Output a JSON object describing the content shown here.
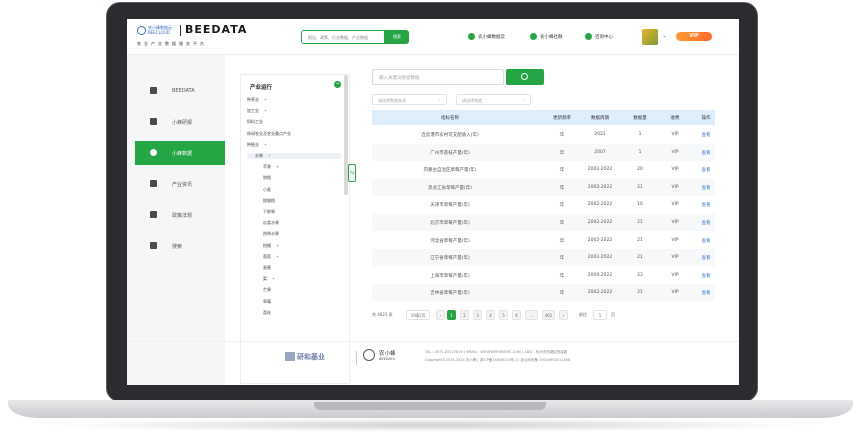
{
  "header": {
    "logo_cn": "农小蜂数据云",
    "logo_en": "BEECLOUD",
    "brand": "BEEDATA",
    "slogan": "农业产业数据服务平台",
    "search_placeholder": "报告、政策、行业数据、产业数据",
    "search_button": "搜索",
    "nav": [
      "农小蜂数据云",
      "农小蜂社群",
      "咨询中心"
    ],
    "vip": "VIP"
  },
  "sidebar": {
    "items": [
      {
        "label": "BEEDATA",
        "icon": "home-icon",
        "active": false
      },
      {
        "label": "小蜂研报",
        "icon": "report-icon",
        "active": false
      },
      {
        "label": "小蜂数据",
        "icon": "cloud-icon",
        "active": true
      },
      {
        "label": "产业资讯",
        "icon": "news-icon",
        "active": false
      },
      {
        "label": "政策法规",
        "icon": "grid-icon",
        "active": false
      },
      {
        "label": "搜索",
        "icon": "search-icon",
        "active": false
      }
    ]
  },
  "tree": {
    "title": "产业运行",
    "nodes": [
      {
        "label": "种养业",
        "plus": true,
        "indent": 0
      },
      {
        "label": "加工业",
        "plus": true,
        "indent": 0
      },
      {
        "label": "饲料工业",
        "plus": false,
        "indent": 0
      },
      {
        "label": "休闲农业及农业重点产业",
        "plus": false,
        "indent": 0
      },
      {
        "label": "种植业",
        "plus": true,
        "indent": 0
      },
      {
        "label": "水果",
        "plus": true,
        "indent": 1,
        "selected": true
      },
      {
        "label": "苹果",
        "plus": true,
        "indent": 2
      },
      {
        "label": "脐橙",
        "plus": false,
        "indent": 2
      },
      {
        "label": "小麦",
        "plus": false,
        "indent": 2
      },
      {
        "label": "猕猴桃",
        "plus": false,
        "indent": 2
      },
      {
        "label": "干鲜果",
        "plus": false,
        "indent": 2
      },
      {
        "label": "瓜类水果",
        "plus": false,
        "indent": 2
      },
      {
        "label": "热带水果",
        "plus": false,
        "indent": 2
      },
      {
        "label": "柑橘",
        "plus": true,
        "indent": 2
      },
      {
        "label": "葡萄",
        "plus": true,
        "indent": 2
      },
      {
        "label": "香蕉",
        "plus": false,
        "indent": 2
      },
      {
        "label": "梨",
        "plus": true,
        "indent": 2
      },
      {
        "label": "芒果",
        "plus": false,
        "indent": 2
      },
      {
        "label": "草莓",
        "plus": false,
        "indent": 2
      },
      {
        "label": "荔枝",
        "plus": false,
        "indent": 2
      }
    ]
  },
  "filters": {
    "search_placeholder": "输入关键词搜索数据",
    "select1": "请选择数据来源",
    "select2": "请选择频度"
  },
  "table": {
    "headers": [
      "指标名称",
      "更新频率",
      "数据周期",
      "数据量",
      "收费",
      "操作"
    ],
    "rows": [
      [
        "连云港市农村可支配收入(年)",
        "年",
        "2021",
        "1",
        "VIP",
        "查看"
      ],
      [
        "广州市荔枝产量(年)",
        "年",
        "2007",
        "1",
        "VIP",
        "查看"
      ],
      [
        "内蒙古自治区草莓产量(年)",
        "年",
        "2002-2022",
        "20",
        "VIP",
        "查看"
      ],
      [
        "黑龙江省草莓产量(年)",
        "年",
        "2002-2022",
        "21",
        "VIP",
        "查看"
      ],
      [
        "天津市草莓产量(年)",
        "年",
        "2002-2022",
        "10",
        "VIP",
        "查看"
      ],
      [
        "北京市草莓产量(年)",
        "年",
        "2002-2022",
        "21",
        "VIP",
        "查看"
      ],
      [
        "河北省草莓产量(年)",
        "年",
        "2002-2022",
        "21",
        "VIP",
        "查看"
      ],
      [
        "辽宁省草莓产量(年)",
        "年",
        "2002-2022",
        "21",
        "VIP",
        "查看"
      ],
      [
        "上海市草莓产量(年)",
        "年",
        "2000-2022",
        "23",
        "VIP",
        "查看"
      ],
      [
        "吉林省草莓产量(年)",
        "年",
        "2002-2022",
        "21",
        "VIP",
        "查看"
      ]
    ]
  },
  "pager": {
    "total": "共 4623 条",
    "page_size": "10条/页",
    "pages": [
      "1",
      "2",
      "3",
      "4",
      "5",
      "6",
      "...",
      "461"
    ],
    "current": "1",
    "goto_label": "前往",
    "goto_value": "1",
    "goto_unit": "页"
  },
  "footer": {
    "logo1": "研和基业",
    "logo2": "农小蜂",
    "logo2_en": "BEEDATA",
    "info1": "TEL：0571-85137819 | EMAIL：WEI@WEIHENGYC.COM | ADD：杭州市西湖区西溪路",
    "info2": "Copyright©2016-2024 农小蜂 | 浙ICP备16006024号-1 | 浙公网安备 33010602011608"
  },
  "colors": {
    "accent": "#24a644",
    "vip": "#ff7a2e",
    "table_header": "#dfeefb",
    "link": "#3a7bd5"
  }
}
